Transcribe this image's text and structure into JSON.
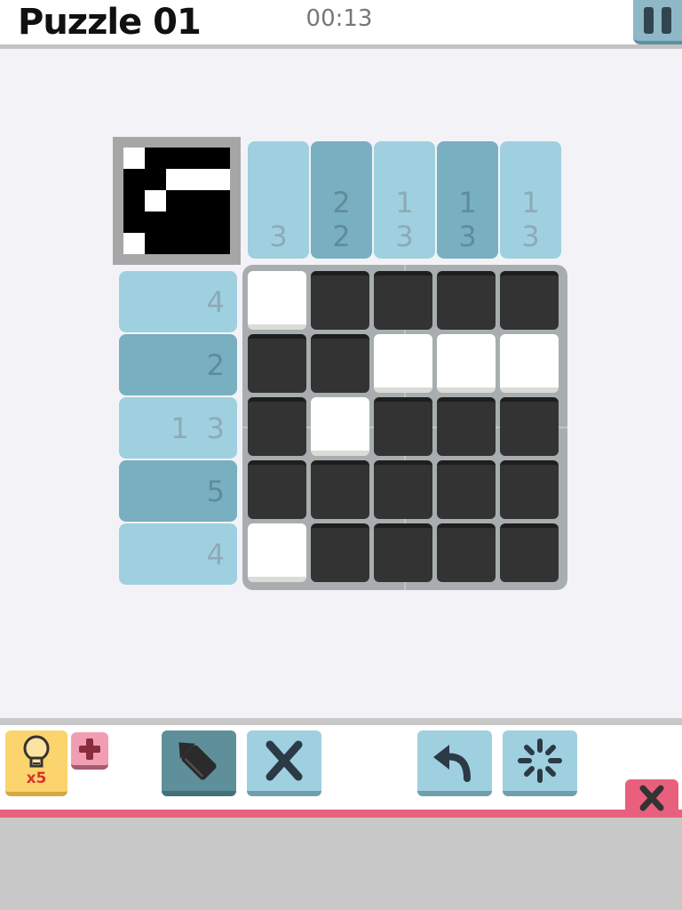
{
  "header": {
    "title": "Puzzle 01",
    "timer": "00:13"
  },
  "icons": {
    "pause": "pause-icon",
    "hint": "lightbulb-icon",
    "plus": "plus-icon",
    "pencil": "pencil-icon",
    "cross": "cross-mark-icon",
    "undo": "undo-icon",
    "reset": "reset-spinner-icon",
    "close": "close-icon"
  },
  "colors": {
    "accent": "#9fd0e0",
    "accent_dark": "#78afc1",
    "filled": "#333333",
    "pink": "#e8607d",
    "hint": "#fbd46d"
  },
  "column_clues": [
    [
      "3"
    ],
    [
      "2",
      "2"
    ],
    [
      "1",
      "3"
    ],
    [
      "1",
      "3"
    ],
    [
      "1",
      "3"
    ]
  ],
  "row_clues": [
    [
      "4"
    ],
    [
      "2"
    ],
    [
      "1",
      "3"
    ],
    [
      "5"
    ],
    [
      "4"
    ]
  ],
  "grid": [
    [
      0,
      1,
      1,
      1,
      1
    ],
    [
      1,
      1,
      0,
      0,
      0
    ],
    [
      1,
      0,
      1,
      1,
      1
    ],
    [
      1,
      1,
      1,
      1,
      1
    ],
    [
      0,
      1,
      1,
      1,
      1
    ]
  ],
  "hint": {
    "count": "x5"
  }
}
